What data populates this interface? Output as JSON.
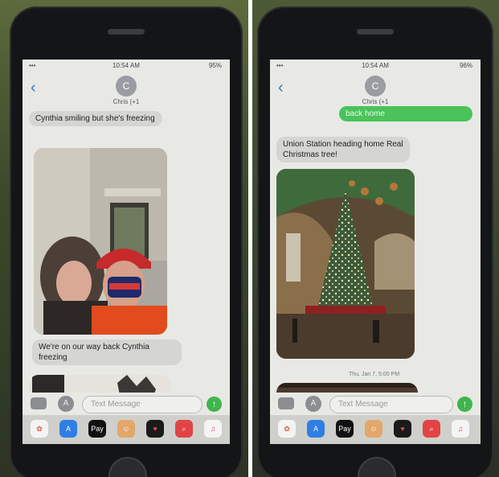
{
  "left": {
    "status": {
      "time": "10:54 AM",
      "battery": "95%"
    },
    "contact": {
      "initial": "C",
      "name": "Chris (+1"
    },
    "messages": [
      "Cynthia smiling but she's freezing",
      "We're on our way back Cynthia freezing"
    ],
    "composer": {
      "placeholder": "Text Message"
    },
    "tray_apps": [
      "photos-icon",
      "app-store-icon",
      "apple-pay-icon",
      "memoji-icon",
      "digital-touch-icon",
      "search-images-icon",
      "music-icon"
    ],
    "tray_labels": {
      "applepay": "Pay",
      "music": "♫"
    }
  },
  "right": {
    "status": {
      "time": "10:54 AM",
      "battery": "96%"
    },
    "contact": {
      "initial": "C",
      "name": "Chris (+1"
    },
    "messages": [
      "back home",
      "Union Station heading home Real Christmas tree!"
    ],
    "timestamp": "Thu, Jan 7, 5:00 PM",
    "composer": {
      "placeholder": "Text Message"
    },
    "tray_labels": {
      "applepay": "Pay",
      "music": "♫"
    }
  },
  "colors": {
    "imessage_green": "#49c35a",
    "bubble_gray": "#d5d6d2",
    "ios_blue": "#2b7cd3"
  }
}
